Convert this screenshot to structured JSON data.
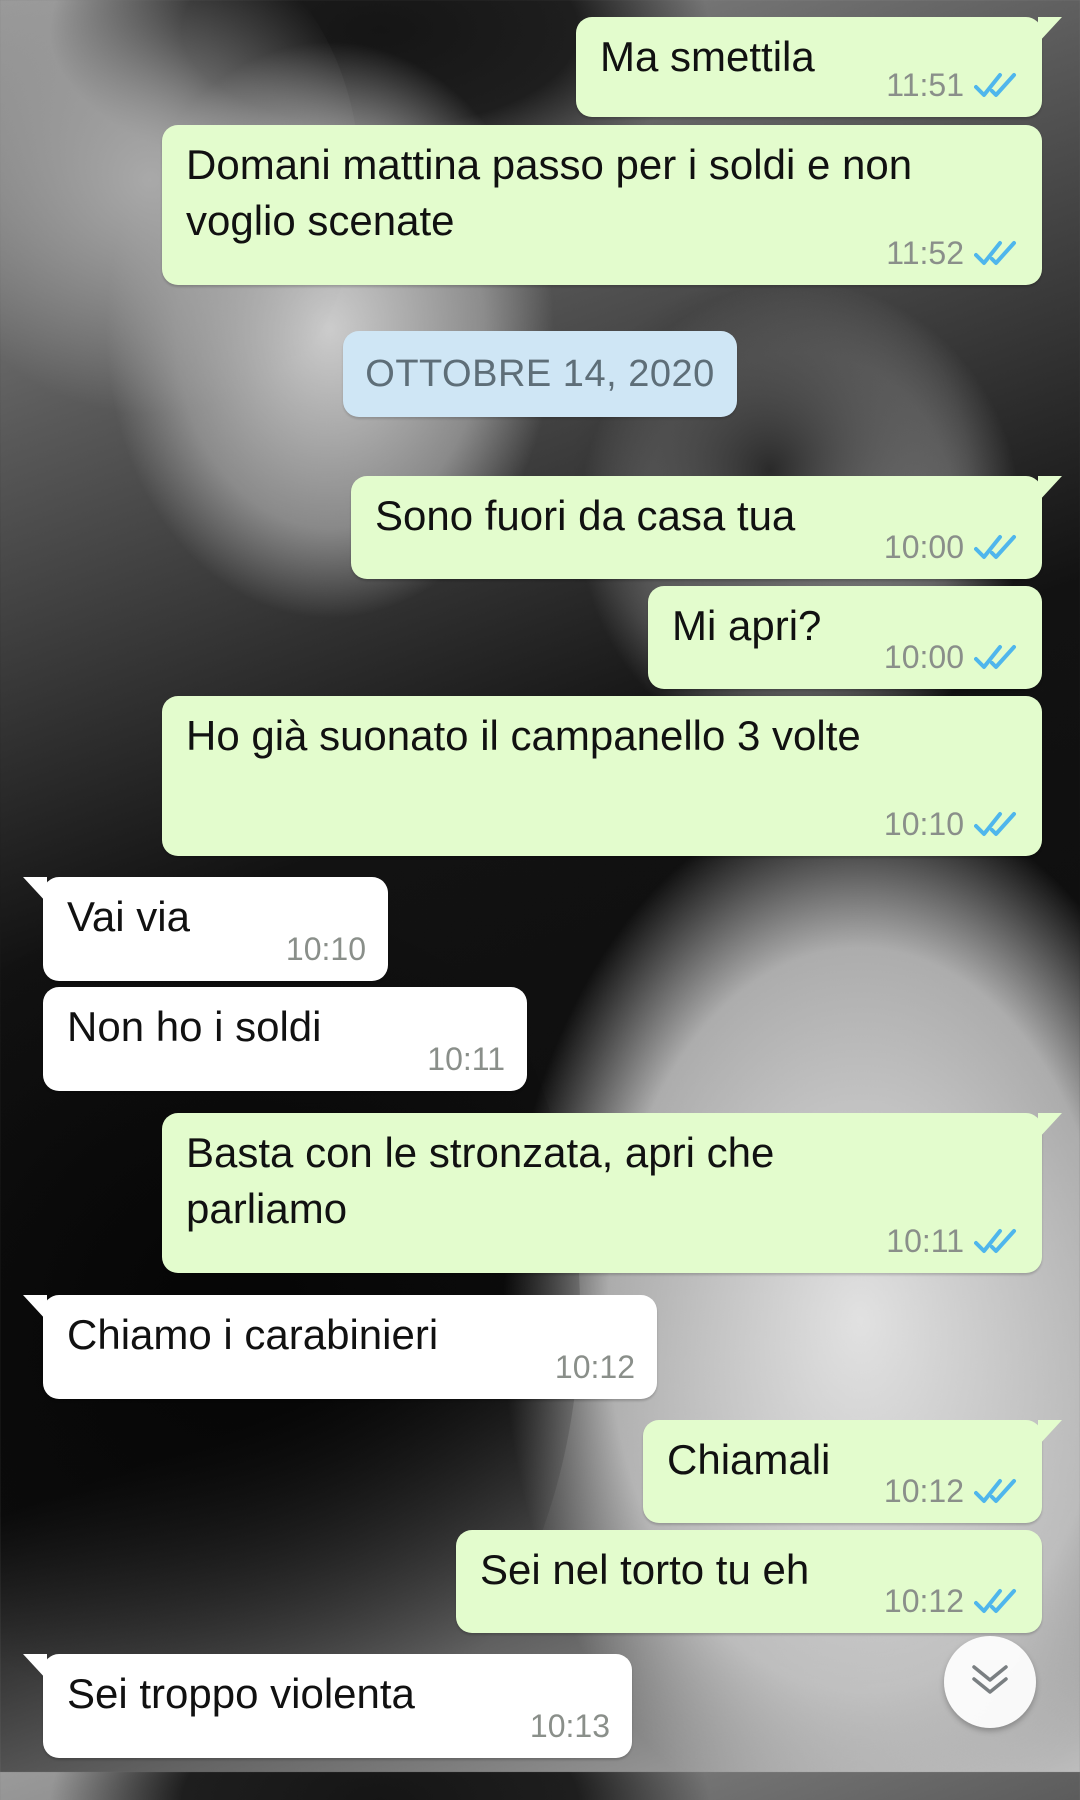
{
  "chat": {
    "date_separator": "OTTOBRE 14, 2020",
    "messages": [
      {
        "dir": "out",
        "text": "Ma smettila",
        "time": "11:51",
        "status": "read"
      },
      {
        "dir": "out",
        "text": "Domani mattina passo per i soldi e non voglio scenate",
        "time": "11:52",
        "status": "read"
      },
      {
        "dir": "out",
        "text": "Sono fuori da casa tua",
        "time": "10:00",
        "status": "read"
      },
      {
        "dir": "out",
        "text": "Mi apri?",
        "time": "10:00",
        "status": "read"
      },
      {
        "dir": "out",
        "text": "Ho già suonato il campanello 3 volte",
        "time": "10:10",
        "status": "read"
      },
      {
        "dir": "in",
        "text": "Vai via",
        "time": "10:10"
      },
      {
        "dir": "in",
        "text": "Non ho i soldi",
        "time": "10:11"
      },
      {
        "dir": "out",
        "text": "Basta con le stronzata, apri che parliamo",
        "time": "10:11",
        "status": "read"
      },
      {
        "dir": "in",
        "text": "Chiamo i carabinieri",
        "time": "10:12"
      },
      {
        "dir": "out",
        "text": "Chiamali",
        "time": "10:12",
        "status": "read"
      },
      {
        "dir": "out",
        "text": "Sei nel torto tu eh",
        "time": "10:12",
        "status": "read"
      },
      {
        "dir": "in",
        "text": "Sei troppo violenta",
        "time": "10:13"
      }
    ]
  },
  "icons": {
    "read_receipt": "double-check-icon",
    "scroll_down": "chevron-double-down-icon"
  },
  "colors": {
    "outgoing_bubble": "#e3fccd",
    "incoming_bubble": "#ffffff",
    "date_pill": "#cfe6f5",
    "read_ticks": "#4fb6ec",
    "timestamp": "#8a8f8a"
  }
}
